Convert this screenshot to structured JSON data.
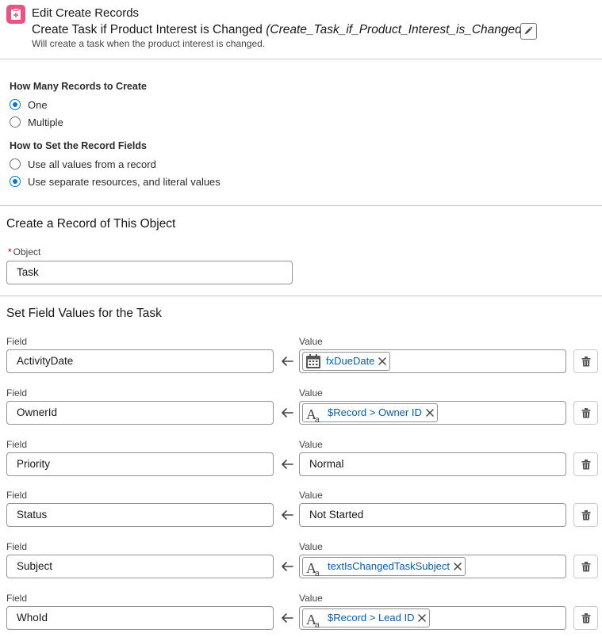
{
  "header": {
    "label": "Edit Create Records",
    "title": "Create Task if Product Interest is Changed",
    "api_name": "(Create_Task_if_Product_Interest_is_Changed)",
    "description": "Will create a task when the product interest is changed.",
    "icon": "clipboard-plus-icon"
  },
  "how_many": {
    "label": "How Many Records to Create",
    "options": [
      {
        "label": "One",
        "selected": true
      },
      {
        "label": "Multiple",
        "selected": false
      }
    ]
  },
  "how_set": {
    "label": "How to Set the Record Fields",
    "options": [
      {
        "label": "Use all values from a record",
        "selected": false
      },
      {
        "label": "Use separate resources, and literal values",
        "selected": true
      }
    ]
  },
  "object_section": {
    "title": "Create a Record of This Object",
    "required_mark": "*",
    "object_label": "Object",
    "object_value": "Task"
  },
  "fields_section": {
    "title": "Set Field Values for the Task",
    "field_label": "Field",
    "value_label": "Value",
    "rows": [
      {
        "field": "ActivityDate",
        "value": "fxDueDate",
        "value_type": "formula-icon"
      },
      {
        "field": "OwnerId",
        "value": "$Record > Owner ID",
        "value_type": "text-resource-icon"
      },
      {
        "field": "Priority",
        "value": "Normal",
        "value_type": "literal"
      },
      {
        "field": "Status",
        "value": "Not Started",
        "value_type": "literal"
      },
      {
        "field": "Subject",
        "value": "textIsChangedTaskSubject",
        "value_type": "text-resource-icon"
      },
      {
        "field": "WhoId",
        "value": "$Record > Lead ID",
        "value_type": "text-resource-icon"
      }
    ]
  },
  "colors": {
    "accent": "#0176d3",
    "header_icon": "#ea5481",
    "pill_text": "#0b5cab"
  }
}
